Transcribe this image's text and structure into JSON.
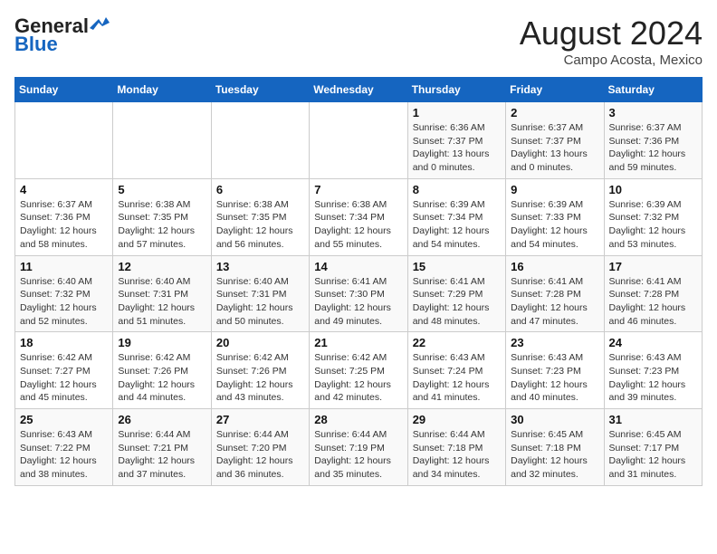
{
  "header": {
    "logo_general": "General",
    "logo_blue": "Blue",
    "month_year": "August 2024",
    "location": "Campo Acosta, Mexico"
  },
  "weekdays": [
    "Sunday",
    "Monday",
    "Tuesday",
    "Wednesday",
    "Thursday",
    "Friday",
    "Saturday"
  ],
  "weeks": [
    [
      {
        "day": "",
        "info": ""
      },
      {
        "day": "",
        "info": ""
      },
      {
        "day": "",
        "info": ""
      },
      {
        "day": "",
        "info": ""
      },
      {
        "day": "1",
        "info": "Sunrise: 6:36 AM\nSunset: 7:37 PM\nDaylight: 13 hours\nand 0 minutes."
      },
      {
        "day": "2",
        "info": "Sunrise: 6:37 AM\nSunset: 7:37 PM\nDaylight: 13 hours\nand 0 minutes."
      },
      {
        "day": "3",
        "info": "Sunrise: 6:37 AM\nSunset: 7:36 PM\nDaylight: 12 hours\nand 59 minutes."
      }
    ],
    [
      {
        "day": "4",
        "info": "Sunrise: 6:37 AM\nSunset: 7:36 PM\nDaylight: 12 hours\nand 58 minutes."
      },
      {
        "day": "5",
        "info": "Sunrise: 6:38 AM\nSunset: 7:35 PM\nDaylight: 12 hours\nand 57 minutes."
      },
      {
        "day": "6",
        "info": "Sunrise: 6:38 AM\nSunset: 7:35 PM\nDaylight: 12 hours\nand 56 minutes."
      },
      {
        "day": "7",
        "info": "Sunrise: 6:38 AM\nSunset: 7:34 PM\nDaylight: 12 hours\nand 55 minutes."
      },
      {
        "day": "8",
        "info": "Sunrise: 6:39 AM\nSunset: 7:34 PM\nDaylight: 12 hours\nand 54 minutes."
      },
      {
        "day": "9",
        "info": "Sunrise: 6:39 AM\nSunset: 7:33 PM\nDaylight: 12 hours\nand 54 minutes."
      },
      {
        "day": "10",
        "info": "Sunrise: 6:39 AM\nSunset: 7:32 PM\nDaylight: 12 hours\nand 53 minutes."
      }
    ],
    [
      {
        "day": "11",
        "info": "Sunrise: 6:40 AM\nSunset: 7:32 PM\nDaylight: 12 hours\nand 52 minutes."
      },
      {
        "day": "12",
        "info": "Sunrise: 6:40 AM\nSunset: 7:31 PM\nDaylight: 12 hours\nand 51 minutes."
      },
      {
        "day": "13",
        "info": "Sunrise: 6:40 AM\nSunset: 7:31 PM\nDaylight: 12 hours\nand 50 minutes."
      },
      {
        "day": "14",
        "info": "Sunrise: 6:41 AM\nSunset: 7:30 PM\nDaylight: 12 hours\nand 49 minutes."
      },
      {
        "day": "15",
        "info": "Sunrise: 6:41 AM\nSunset: 7:29 PM\nDaylight: 12 hours\nand 48 minutes."
      },
      {
        "day": "16",
        "info": "Sunrise: 6:41 AM\nSunset: 7:28 PM\nDaylight: 12 hours\nand 47 minutes."
      },
      {
        "day": "17",
        "info": "Sunrise: 6:41 AM\nSunset: 7:28 PM\nDaylight: 12 hours\nand 46 minutes."
      }
    ],
    [
      {
        "day": "18",
        "info": "Sunrise: 6:42 AM\nSunset: 7:27 PM\nDaylight: 12 hours\nand 45 minutes."
      },
      {
        "day": "19",
        "info": "Sunrise: 6:42 AM\nSunset: 7:26 PM\nDaylight: 12 hours\nand 44 minutes."
      },
      {
        "day": "20",
        "info": "Sunrise: 6:42 AM\nSunset: 7:26 PM\nDaylight: 12 hours\nand 43 minutes."
      },
      {
        "day": "21",
        "info": "Sunrise: 6:42 AM\nSunset: 7:25 PM\nDaylight: 12 hours\nand 42 minutes."
      },
      {
        "day": "22",
        "info": "Sunrise: 6:43 AM\nSunset: 7:24 PM\nDaylight: 12 hours\nand 41 minutes."
      },
      {
        "day": "23",
        "info": "Sunrise: 6:43 AM\nSunset: 7:23 PM\nDaylight: 12 hours\nand 40 minutes."
      },
      {
        "day": "24",
        "info": "Sunrise: 6:43 AM\nSunset: 7:23 PM\nDaylight: 12 hours\nand 39 minutes."
      }
    ],
    [
      {
        "day": "25",
        "info": "Sunrise: 6:43 AM\nSunset: 7:22 PM\nDaylight: 12 hours\nand 38 minutes."
      },
      {
        "day": "26",
        "info": "Sunrise: 6:44 AM\nSunset: 7:21 PM\nDaylight: 12 hours\nand 37 minutes."
      },
      {
        "day": "27",
        "info": "Sunrise: 6:44 AM\nSunset: 7:20 PM\nDaylight: 12 hours\nand 36 minutes."
      },
      {
        "day": "28",
        "info": "Sunrise: 6:44 AM\nSunset: 7:19 PM\nDaylight: 12 hours\nand 35 minutes."
      },
      {
        "day": "29",
        "info": "Sunrise: 6:44 AM\nSunset: 7:18 PM\nDaylight: 12 hours\nand 34 minutes."
      },
      {
        "day": "30",
        "info": "Sunrise: 6:45 AM\nSunset: 7:18 PM\nDaylight: 12 hours\nand 32 minutes."
      },
      {
        "day": "31",
        "info": "Sunrise: 6:45 AM\nSunset: 7:17 PM\nDaylight: 12 hours\nand 31 minutes."
      }
    ]
  ]
}
